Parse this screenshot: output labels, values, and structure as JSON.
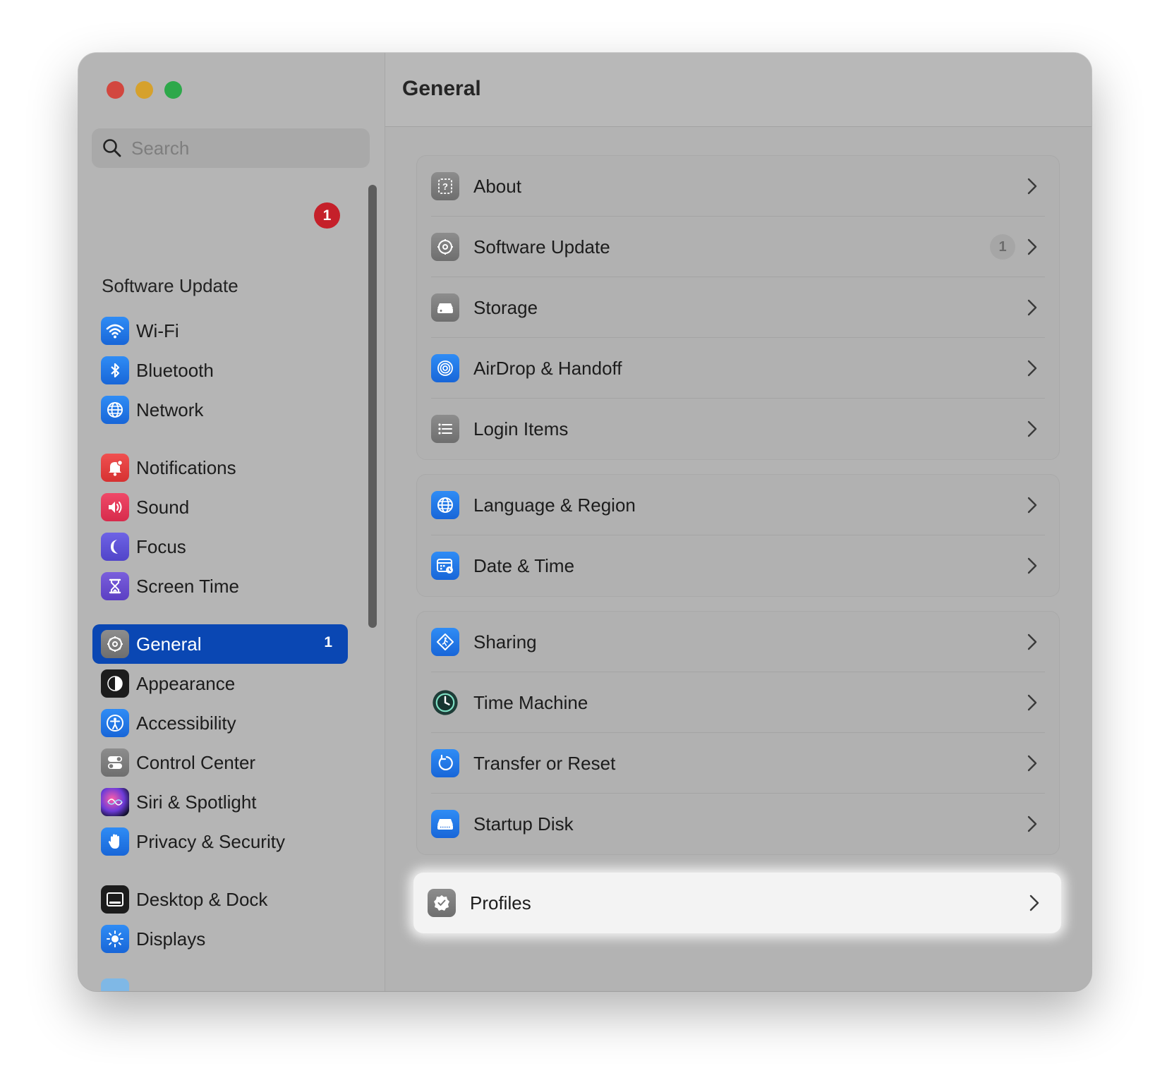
{
  "window": {
    "title": "General"
  },
  "search": {
    "placeholder": "Search"
  },
  "sidebar": {
    "notification_badge": "1",
    "software_update_text": "Software Update",
    "items": [
      {
        "label": "Wi-Fi",
        "icon": "wifi-icon"
      },
      {
        "label": "Bluetooth",
        "icon": "bluetooth-icon"
      },
      {
        "label": "Network",
        "icon": "globe-icon"
      },
      {
        "label": "Notifications",
        "icon": "bell-icon"
      },
      {
        "label": "Sound",
        "icon": "speaker-icon"
      },
      {
        "label": "Focus",
        "icon": "moon-icon"
      },
      {
        "label": "Screen Time",
        "icon": "hourglass-icon"
      },
      {
        "label": "General",
        "icon": "gear-icon",
        "selected": true,
        "count": "1"
      },
      {
        "label": "Appearance",
        "icon": "appearance-icon"
      },
      {
        "label": "Accessibility",
        "icon": "accessibility-icon"
      },
      {
        "label": "Control Center",
        "icon": "toggles-icon"
      },
      {
        "label": "Siri & Spotlight",
        "icon": "siri-icon"
      },
      {
        "label": "Privacy & Security",
        "icon": "hand-icon"
      },
      {
        "label": "Desktop & Dock",
        "icon": "dock-icon"
      },
      {
        "label": "Displays",
        "icon": "sun-icon"
      }
    ]
  },
  "main": {
    "groups": [
      {
        "rows": [
          {
            "label": "About",
            "icon": "info-icon"
          },
          {
            "label": "Software Update",
            "icon": "gear-badge-icon",
            "count": "1"
          },
          {
            "label": "Storage",
            "icon": "drive-icon"
          },
          {
            "label": "AirDrop & Handoff",
            "icon": "airdrop-icon"
          },
          {
            "label": "Login Items",
            "icon": "list-icon"
          }
        ]
      },
      {
        "rows": [
          {
            "label": "Language & Region",
            "icon": "globe-icon"
          },
          {
            "label": "Date & Time",
            "icon": "calendar-clock-icon"
          }
        ]
      },
      {
        "rows": [
          {
            "label": "Sharing",
            "icon": "sharing-icon"
          },
          {
            "label": "Time Machine",
            "icon": "time-machine-icon"
          },
          {
            "label": "Transfer or Reset",
            "icon": "reset-icon"
          },
          {
            "label": "Startup Disk",
            "icon": "disk-icon"
          }
        ]
      },
      {
        "rows": [
          {
            "label": "Profiles",
            "icon": "checkmark-badge-icon",
            "highlighted": true
          }
        ]
      }
    ]
  },
  "colors": {
    "accent": "#0a47b3",
    "badge_red": "#c5202a",
    "close": "#d2473f",
    "minimize": "#d6a12c",
    "maximize": "#2da84a"
  }
}
